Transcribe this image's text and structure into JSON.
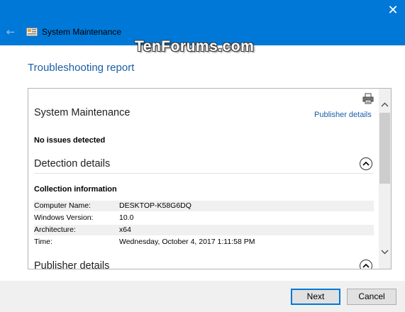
{
  "window": {
    "title": "System Maintenance",
    "back_glyph": "←",
    "close_glyph": "✕",
    "accent_color": "#0078d7"
  },
  "watermark": "TenForums.com",
  "page": {
    "heading": "Troubleshooting report"
  },
  "report": {
    "title": "System Maintenance",
    "publisher_link": "Publisher details",
    "status": "No issues detected",
    "detection_heading": "Detection details",
    "collection_heading": "Collection information",
    "info": [
      {
        "key": "Computer Name:",
        "value": "DESKTOP-K58G6DQ"
      },
      {
        "key": "Windows Version:",
        "value": "10.0"
      },
      {
        "key": "Architecture:",
        "value": "x64"
      },
      {
        "key": "Time:",
        "value": "Wednesday, October 4, 2017 1:11:58 PM"
      }
    ],
    "publisher_heading": "Publisher details"
  },
  "icons": {
    "print": "printer-icon",
    "collapse": "chevron-up-circle-icon",
    "scroll_up": "scroll-up-arrow-icon",
    "scroll_down": "scroll-down-arrow-icon"
  },
  "buttons": {
    "next": "Next",
    "cancel": "Cancel"
  }
}
